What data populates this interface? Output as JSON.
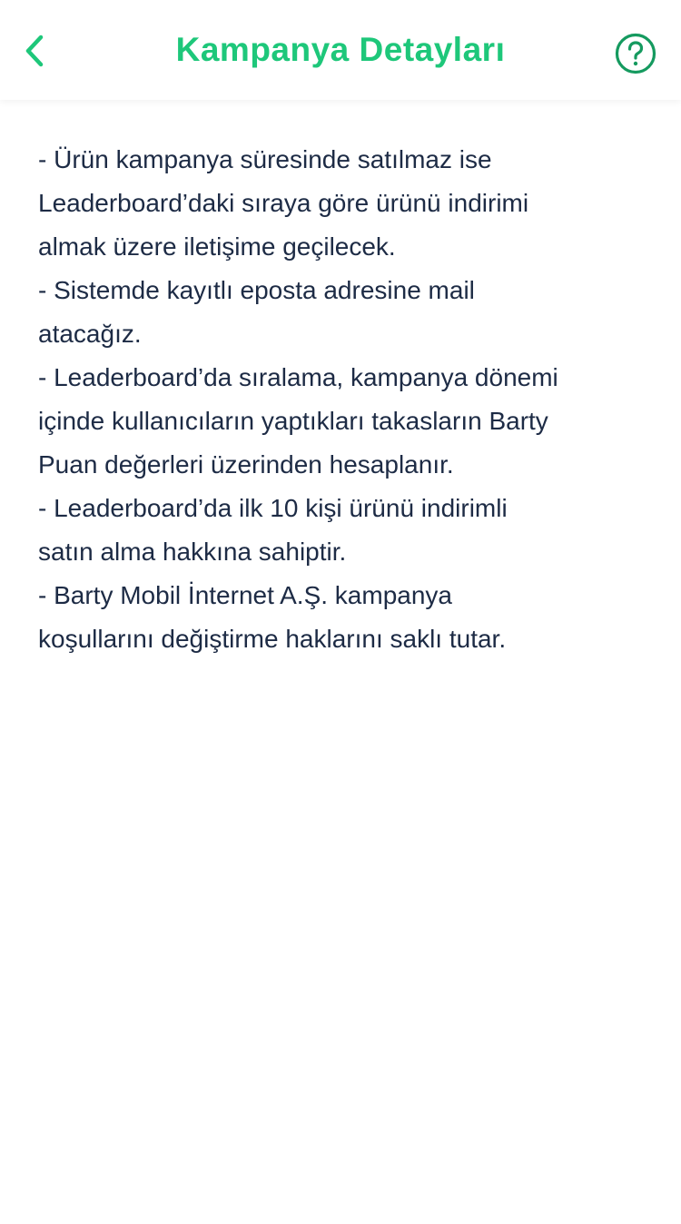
{
  "colors": {
    "accent": "#1ec77a",
    "text": "#1d2b45",
    "background": "#ffffff"
  },
  "header": {
    "title": "Kampanya Detayları",
    "back_icon": "chevron-left-icon",
    "help_icon": "question-circle-icon"
  },
  "content": {
    "lines": [
      "- Ürün kampanya süresinde satılmaz ise",
      "Leaderboard’daki sıraya göre ürünü indirimi",
      "almak üzere iletişime geçilecek.",
      "- Sistemde kayıtlı eposta adresine mail",
      "atacağız.",
      "- Leaderboard’da sıralama, kampanya dönemi",
      "içinde kullanıcıların yaptıkları takasların Barty",
      "Puan değerleri üzerinden hesaplanır.",
      "- Leaderboard’da ilk 10 kişi ürünü indirimli",
      "satın alma hakkına sahiptir.",
      "- Barty Mobil İnternet A.Ş. kampanya",
      "koşullarını değiştirme haklarını saklı tutar."
    ]
  }
}
